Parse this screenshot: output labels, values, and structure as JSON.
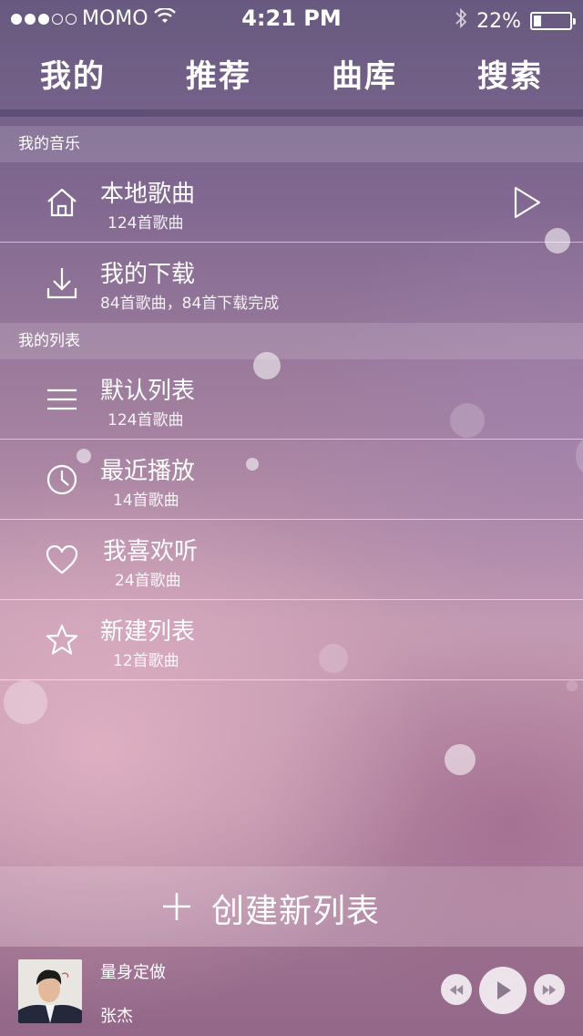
{
  "status_bar": {
    "carrier": "MOMO",
    "time": "4:21 PM",
    "battery": "22%",
    "battery_level": 0.22,
    "signal_dots": 5,
    "signal_filled": 3
  },
  "tabs": [
    {
      "label": "我的",
      "active": true
    },
    {
      "label": "推荐",
      "active": false
    },
    {
      "label": "曲库",
      "active": false
    },
    {
      "label": "搜索",
      "active": false
    }
  ],
  "sections": {
    "music": {
      "header": "我的音乐",
      "items": [
        {
          "title": "本地歌曲",
          "subtitle": "124首歌曲",
          "icon": "home-icon"
        },
        {
          "title": "我的下载",
          "subtitle": "84首歌曲，84首下载完成",
          "icon": "download-icon"
        }
      ]
    },
    "lists": {
      "header": "我的列表",
      "items": [
        {
          "title": "默认列表",
          "subtitle": "124首歌曲",
          "icon": "list-icon"
        },
        {
          "title": "最近播放",
          "subtitle": "14首歌曲",
          "icon": "clock-icon"
        },
        {
          "title": "我喜欢听",
          "subtitle": "24首歌曲",
          "icon": "heart-icon"
        },
        {
          "title": "新建列表",
          "subtitle": "12首歌曲",
          "icon": "star-icon"
        }
      ]
    }
  },
  "create_list": {
    "label": "创建新列表",
    "icon": "plus-icon"
  },
  "player": {
    "song": "量身定做",
    "artist": "张杰",
    "controls": [
      "rewind-icon",
      "play-icon",
      "fast-forward-icon"
    ]
  },
  "colors": {
    "tab_indicator": "#5e4f77",
    "bg_top": "#67597f",
    "bg_mid": "#c69cb3",
    "bg_bottom": "#9d6f91"
  }
}
